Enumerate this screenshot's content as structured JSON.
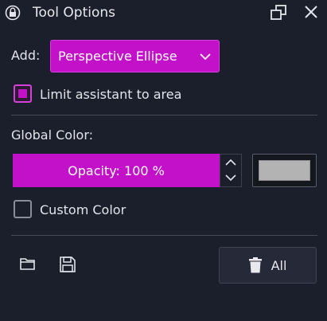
{
  "window": {
    "title": "Tool Options",
    "icons": {
      "lock": "lock-icon",
      "float": "float-window-icon",
      "close": "close-icon"
    }
  },
  "add": {
    "label": "Add:",
    "selected": "Perspective Ellipse",
    "chevron": "chevron-down-icon"
  },
  "limit_assistant": {
    "label": "Limit assistant to area",
    "checked": true
  },
  "global_color": {
    "label": "Global Color:",
    "opacity_text": "Opacity: 100 %",
    "opacity_value": 100,
    "swatch_color": "#b3b3b3"
  },
  "custom_color": {
    "label": "Custom Color",
    "checked": false
  },
  "footer": {
    "open_icon": "folder-open-icon",
    "save_icon": "save-icon",
    "delete_all_label": "All",
    "delete_icon": "trash-icon"
  },
  "colors": {
    "accent": "#c211c8",
    "background": "#1b1e2b",
    "text": "#e3e5ec"
  }
}
